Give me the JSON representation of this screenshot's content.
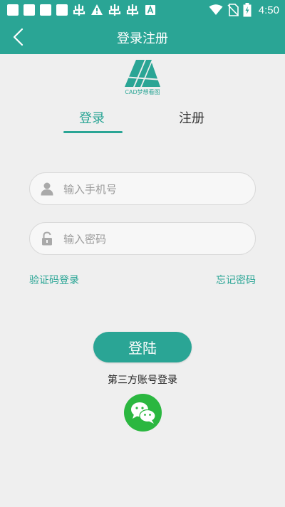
{
  "status_bar": {
    "time": "4:50",
    "colors": {
      "background": "#2aa595"
    },
    "left_icons": [
      "notification-box",
      "notification-box",
      "notification-box",
      "notification-box",
      "app-glyph",
      "warning",
      "app-glyph",
      "app-glyph",
      "app-a"
    ],
    "right_icons": [
      "wifi",
      "no-sim",
      "battery-charging"
    ]
  },
  "header": {
    "title": "登录注册",
    "back_icon": "chevron-left-icon"
  },
  "logo": {
    "caption": "CAD梦想看图"
  },
  "tabs": [
    {
      "label": "登录",
      "active": true
    },
    {
      "label": "注册",
      "active": false
    }
  ],
  "form": {
    "phone": {
      "placeholder": "输入手机号",
      "value": "",
      "icon": "user-icon"
    },
    "password": {
      "placeholder": "输入密码",
      "value": "",
      "icon": "lock-icon"
    }
  },
  "links": {
    "sms_login": "验证码登录",
    "forgot_password": "忘记密码"
  },
  "login_button": {
    "label": "登陆"
  },
  "third_party": {
    "label": "第三方账号登录",
    "providers": [
      {
        "name": "wechat",
        "icon": "wechat-icon",
        "color": "#2bb740"
      }
    ]
  },
  "colors": {
    "accent": "#2aa595",
    "background": "#efefef"
  }
}
